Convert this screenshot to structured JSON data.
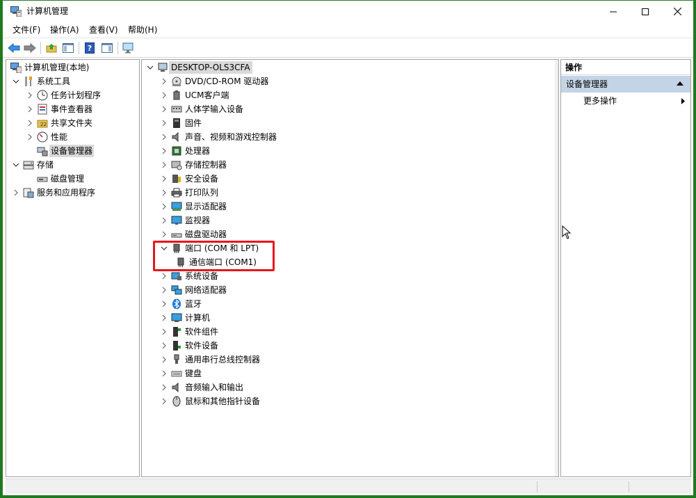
{
  "window": {
    "title": "计算机管理"
  },
  "menu": [
    {
      "label": "文件(F)"
    },
    {
      "label": "操作(A)"
    },
    {
      "label": "查看(V)"
    },
    {
      "label": "帮助(H)"
    }
  ],
  "toolbar": [
    "back-icon",
    "forward-icon",
    "up-folder-icon",
    "show-hide-tree-icon",
    "help-icon",
    "show-action-pane-icon",
    "monitor-icon"
  ],
  "left_tree": {
    "root": "计算机管理(本地)",
    "items": [
      {
        "label": "系统工具",
        "icon": "tools-icon"
      },
      {
        "label": "任务计划程序",
        "icon": "clock-icon"
      },
      {
        "label": "事件查看器",
        "icon": "event-viewer-icon"
      },
      {
        "label": "共享文件夹",
        "icon": "shared-folder-icon"
      },
      {
        "label": "性能",
        "icon": "performance-icon"
      },
      {
        "label": "设备管理器",
        "icon": "device-manager-icon"
      },
      {
        "label": "存储",
        "icon": "storage-icon"
      },
      {
        "label": "磁盘管理",
        "icon": "disk-management-icon"
      },
      {
        "label": "服务和应用程序",
        "icon": "services-icon"
      }
    ]
  },
  "device_tree": {
    "root": "DESKTOP-OLS3CFA",
    "items": [
      {
        "label": "DVD/CD-ROM 驱动器",
        "icon": "dvd-drive-icon"
      },
      {
        "label": "UCM客户端",
        "icon": "ucm-client-icon"
      },
      {
        "label": "人体学输入设备",
        "icon": "hid-icon"
      },
      {
        "label": "固件",
        "icon": "firmware-icon"
      },
      {
        "label": "声音、视频和游戏控制器",
        "icon": "speaker-icon"
      },
      {
        "label": "处理器",
        "icon": "processor-icon"
      },
      {
        "label": "存储控制器",
        "icon": "storage-controller-icon"
      },
      {
        "label": "安全设备",
        "icon": "security-device-icon"
      },
      {
        "label": "打印队列",
        "icon": "printer-icon"
      },
      {
        "label": "显示适配器",
        "icon": "display-adapter-icon"
      },
      {
        "label": "监视器",
        "icon": "monitor-icon"
      },
      {
        "label": "磁盘驱动器",
        "icon": "disk-drive-icon"
      },
      {
        "label": "端口 (COM 和 LPT)",
        "icon": "port-icon"
      },
      {
        "label": "通信端口 (COM1)",
        "icon": "port-icon"
      },
      {
        "label": "系统设备",
        "icon": "system-devices-icon"
      },
      {
        "label": "网络适配器",
        "icon": "network-adapter-icon"
      },
      {
        "label": "蓝牙",
        "icon": "bluetooth-icon"
      },
      {
        "label": "计算机",
        "icon": "computer-icon"
      },
      {
        "label": "软件组件",
        "icon": "software-component-icon"
      },
      {
        "label": "软件设备",
        "icon": "software-device-icon"
      },
      {
        "label": "通用串行总线控制器",
        "icon": "usb-icon"
      },
      {
        "label": "键盘",
        "icon": "keyboard-icon"
      },
      {
        "label": "音频输入和输出",
        "icon": "audio-io-icon"
      },
      {
        "label": "鼠标和其他指针设备",
        "icon": "mouse-icon"
      }
    ]
  },
  "actions": {
    "header": "操作",
    "section": "设备管理器",
    "more": "更多操作"
  },
  "colors": {
    "highlight": "#e8141b",
    "selected": "#d9d9d9",
    "section": "#c2d4e6"
  }
}
